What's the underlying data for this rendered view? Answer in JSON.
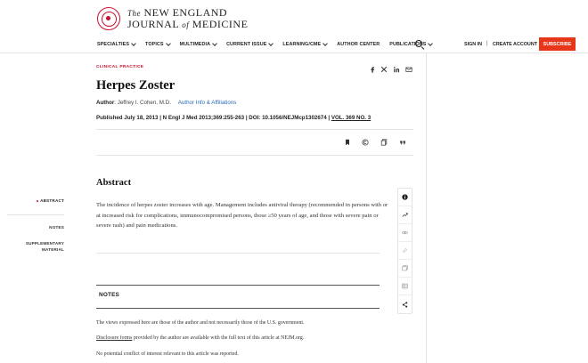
{
  "header": {
    "logo_line1_prefix": "The",
    "logo_line1_main": "NEW ENGLAND",
    "logo_line2_main": "JOURNAL",
    "logo_line2_of": "of",
    "logo_line2_end": "MEDICINE",
    "nav": [
      {
        "label": "SPECIALTIES",
        "has_caret": true
      },
      {
        "label": "TOPICS",
        "has_caret": true
      },
      {
        "label": "MULTIMEDIA",
        "has_caret": true
      },
      {
        "label": "CURRENT ISSUE",
        "has_caret": true
      },
      {
        "label": "LEARNING/CME",
        "has_caret": true
      },
      {
        "label": "AUTHOR CENTER",
        "has_caret": false
      },
      {
        "label": "PUBLICATIONS",
        "has_caret": true
      }
    ],
    "sign_in": "SIGN IN",
    "separator": "|",
    "create_account": "CREATE ACCOUNT",
    "subscribe": "SUBSCRIBE"
  },
  "article": {
    "section_label": "CLINICAL PRACTICE",
    "title": "Herpes Zoster",
    "author_label": "Author",
    "author_name": ": Jeffrey I. Cohen, M.D.",
    "affiliations_link": "Author Info & Affiliations",
    "published_text": "Published July 18, 2013 | N Engl J Med 2013;369:255-263 | DOI: 10.1056/NEJMcp1302674 | ",
    "volume_link": "VOL. 369 NO. 3",
    "abstract_heading": "Abstract",
    "abstract_text": "The incidence of herpes zoster increases with age. Management includes antiviral therapy (recommended in persons with or at increased risk for complications, immunocompromised persons, those ≥50 years of age, and those with severe pain or severe rash) and pain medications."
  },
  "toc": {
    "abstract": "ABSTRACT",
    "notes": "NOTES",
    "supplementary_line1": "SUPPLEMENTARY",
    "supplementary_line2": "MATERIAL"
  },
  "notes": {
    "heading": "NOTES",
    "line1": "The views expressed here are those of the author and not necessarily those of the U.S. government.",
    "line2_link": "Disclosure forms",
    "line2_rest": " provided by the author are available with the full text of this article at NEJM.org.",
    "line3": "No potential conflict of interest relevant to this article was reported."
  },
  "colors": {
    "accent_red": "#c8102e",
    "subscribe_bg": "#e8361a",
    "link_blue": "#2a6ebb"
  }
}
